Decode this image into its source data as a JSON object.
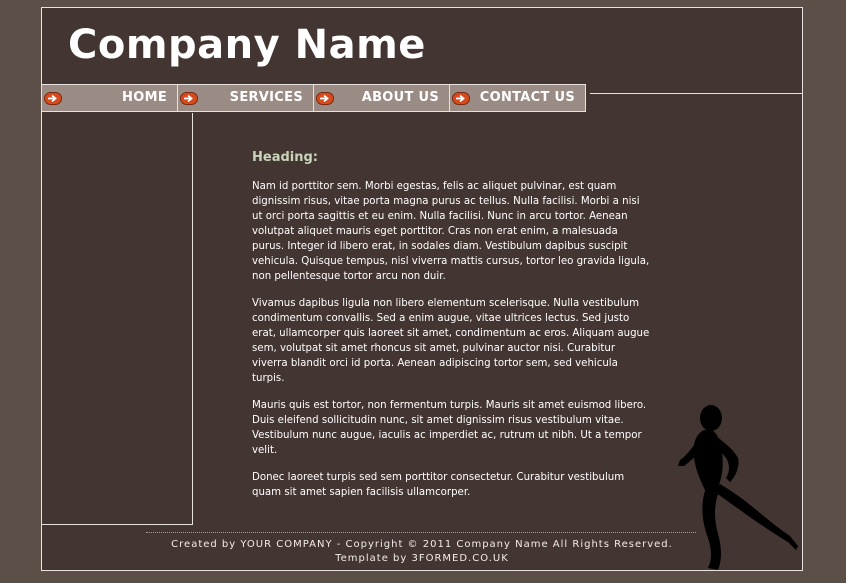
{
  "header": {
    "company_name": "Company Name"
  },
  "nav": {
    "items": [
      {
        "label": "HOME"
      },
      {
        "label": "SERVICES"
      },
      {
        "label": "ABOUT US"
      },
      {
        "label": "CONTACT US"
      }
    ]
  },
  "main": {
    "heading": "Heading:",
    "paragraphs": [
      "Nam id porttitor sem. Morbi egestas, felis ac aliquet pulvinar, est quam dignissim risus, vitae porta magna purus ac tellus. Nulla facilisi. Morbi a nisi ut orci porta sagittis et eu enim. Nulla facilisi. Nunc in arcu tortor. Aenean volutpat aliquet mauris eget porttitor. Cras non erat enim, a malesuada purus. Integer id libero erat, in sodales diam. Vestibulum dapibus suscipit vehicula. Quisque tempus, nisl viverra mattis cursus, tortor leo gravida ligula, non pellentesque tortor arcu non duir.",
      "Vivamus dapibus ligula non libero elementum scelerisque. Nulla vestibulum condimentum convallis. Sed a enim augue, vitae ultrices lectus. Sed justo erat, ullamcorper quis laoreet sit amet, condimentum ac eros. Aliquam augue sem, volutpat sit amet rhoncus sit amet, pulvinar auctor nisi. Curabitur viverra blandit orci id porta. Aenean adipiscing tortor sem, sed vehicula turpis.",
      "Mauris quis est tortor, non fermentum turpis. Mauris sit amet euismod libero. Duis eleifend sollicitudin nunc, sit amet dignissim risus vestibulum vitae. Vestibulum nunc augue, iaculis ac imperdiet ac, rutrum ut nibh. Ut a tempor velit.",
      "Donec laoreet turpis sed sem porttitor consectetur. Curabitur vestibulum quam sit amet sapien facilisis ullamcorper."
    ]
  },
  "footer": {
    "copyright": "Created by YOUR COMPANY - Copyright © 2011 Company Name All Rights Reserved.",
    "template": "Template by 3FORMED.CO.UK"
  },
  "icons": {
    "nav_arrow": "arrow-right-icon",
    "runner": "running-man-icon"
  },
  "colors": {
    "background": "#5b4f48",
    "panel": "#433532",
    "nav": "#9a8b85",
    "accent": "#d64a1e",
    "heading": "#c7d4b8"
  }
}
